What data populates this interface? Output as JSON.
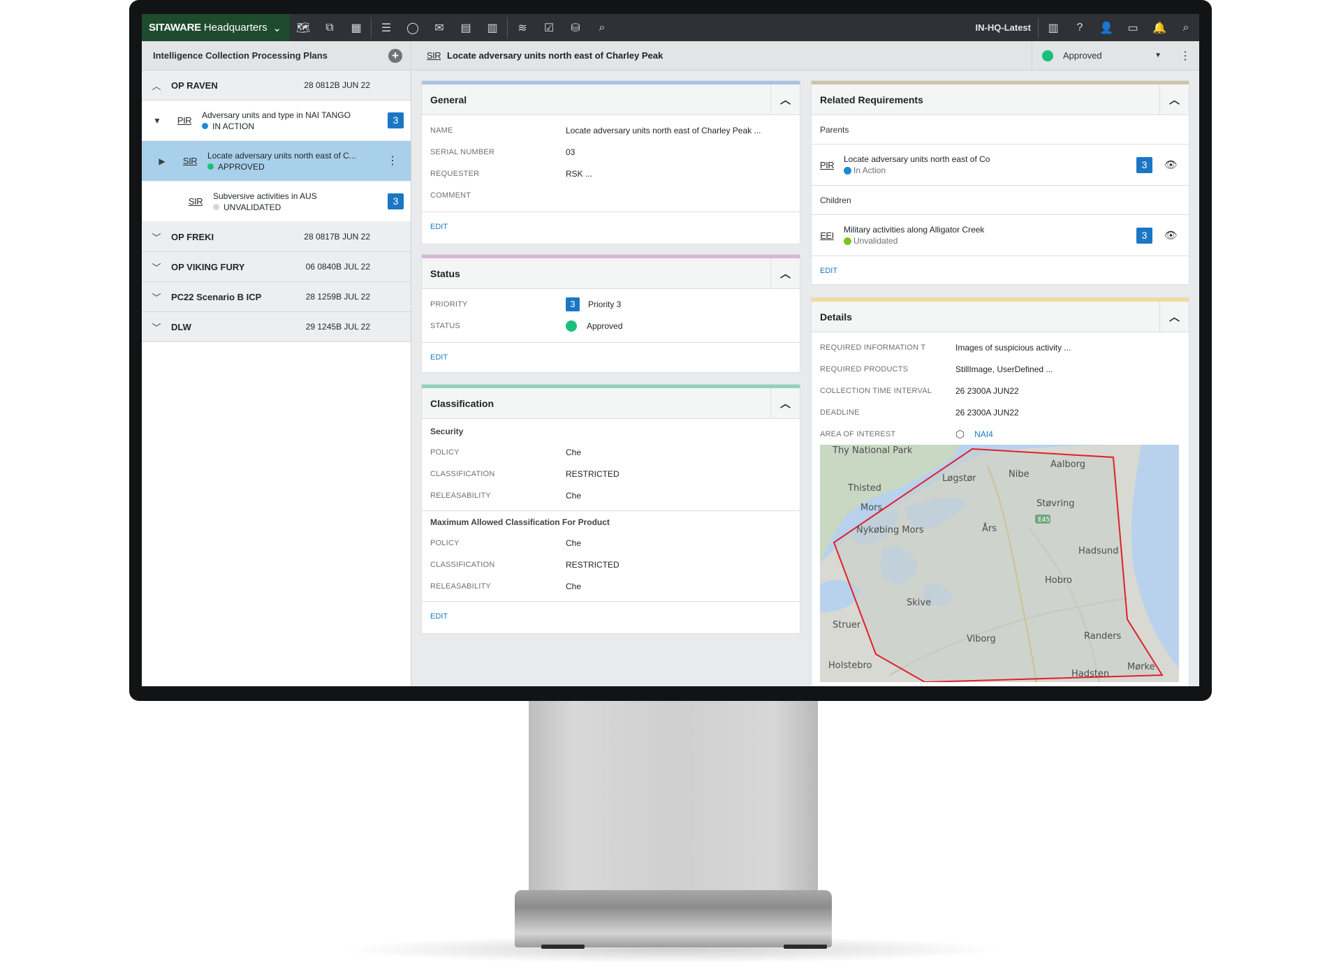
{
  "topbar": {
    "brand_bold": "SITAWARE",
    "brand_rest": "Headquarters",
    "env_label": "IN-HQ-Latest",
    "tool_icons": [
      "map-icon",
      "org-chart-icon",
      "grid-icon",
      "list-icon",
      "chat-icon",
      "mail-icon",
      "document-icon",
      "book-icon",
      "layers-icon",
      "checklist-icon",
      "database-icon",
      "search-icon"
    ],
    "right_icons": [
      "panel-icon",
      "help-icon",
      "user-icon",
      "presentation-icon",
      "bell-icon",
      "search-icon"
    ]
  },
  "left": {
    "title": "Intelligence Collection Processing Plans",
    "ops": [
      {
        "name": "OP RAVEN",
        "date": "28 0812B JUN 22",
        "expanded": true
      },
      {
        "name": "OP FREKI",
        "date": "28 0817B JUN 22"
      },
      {
        "name": "OP VIKING FURY",
        "date": "06 0840B JUL 22"
      },
      {
        "name": "PC22 Scenario B ICP",
        "date": "28 1259B JUL 22"
      },
      {
        "name": "DLW",
        "date": "29 1245B JUL 22"
      }
    ],
    "items": [
      {
        "tag": "PIR",
        "title": "Adversary units and type in NAI TANGO",
        "status": "IN ACTION",
        "badge": "3"
      },
      {
        "tag": "SIR",
        "title": "Locate adversary units north east of C...",
        "status": "APPROVED"
      },
      {
        "tag": "SIR",
        "title": "Subversive activities in AUS",
        "status": "UNVALIDATED",
        "badge": "3"
      }
    ]
  },
  "header": {
    "tag": "SIR",
    "title": "Locate adversary units north east of Charley Peak",
    "status": "Approved"
  },
  "general": {
    "title": "General",
    "rows": [
      {
        "k": "NAME",
        "v": "Locate adversary units north east of Charley Peak ..."
      },
      {
        "k": "SERIAL NUMBER",
        "v": "03"
      },
      {
        "k": "REQUESTER",
        "v": "RSK ..."
      },
      {
        "k": "COMMENT",
        "v": ""
      }
    ],
    "edit": "EDIT"
  },
  "status_card": {
    "title": "Status",
    "priority_label": "PRIORITY",
    "priority_badge": "3",
    "priority_value": "Priority 3",
    "status_label": "STATUS",
    "status_value": "Approved",
    "edit": "EDIT"
  },
  "classification": {
    "title": "Classification",
    "sec1_title": "Security",
    "sec1_rows": [
      {
        "k": "POLICY",
        "v": "Che"
      },
      {
        "k": "CLASSIFICATION",
        "v": "RESTRICTED"
      },
      {
        "k": "RELEASABILITY",
        "v": "Che"
      }
    ],
    "sec2_title": "Maximum Allowed Classification For Product",
    "sec2_rows": [
      {
        "k": "POLICY",
        "v": "Che"
      },
      {
        "k": "CLASSIFICATION",
        "v": "RESTRICTED"
      },
      {
        "k": "RELEASABILITY",
        "v": "Che"
      }
    ],
    "edit": "EDIT"
  },
  "related": {
    "title": "Related Requirements",
    "parents_label": "Parents",
    "parent": {
      "tag": "PIR",
      "title": "Locate adversary units north east of Co",
      "status": "In Action",
      "badge": "3"
    },
    "children_label": "Children",
    "child": {
      "tag": "EEI",
      "title": "Military activities along Alligator Creek",
      "status": "Unvalidated",
      "badge": "3"
    },
    "edit": "EDIT"
  },
  "details": {
    "title": "Details",
    "rows": [
      {
        "k": "REQUIRED INFORMATION T",
        "v": "Images of suspicious activity ..."
      },
      {
        "k": "REQUIRED PRODUCTS",
        "v": "StillImage, UserDefined ..."
      },
      {
        "k": "COLLECTION TIME INTERVAL",
        "v": "26 2300A JUN22"
      },
      {
        "k": "DEADLINE",
        "v": "26 2300A JUN22"
      }
    ],
    "aoi_label": "AREA OF INTEREST",
    "aoi_value": "NAI4",
    "map_places": [
      "Thy National Park",
      "Thisted",
      "Løgstør",
      "Nibe",
      "Aalborg",
      "Støvring",
      "Mors",
      "Nykøbing Mors",
      "Års",
      "Hadsund",
      "Hobro",
      "Skive",
      "Struer",
      "Viborg",
      "Randers",
      "Holstebro",
      "Hadsten",
      "Mørke",
      "E45"
    ]
  },
  "colors": {
    "brand_green": "#1e4a2e",
    "accent_blue": "#1b77c4",
    "selected_row": "#a9d0ea",
    "approved_green": "#19c07a",
    "aoi_red": "#e0202a"
  }
}
